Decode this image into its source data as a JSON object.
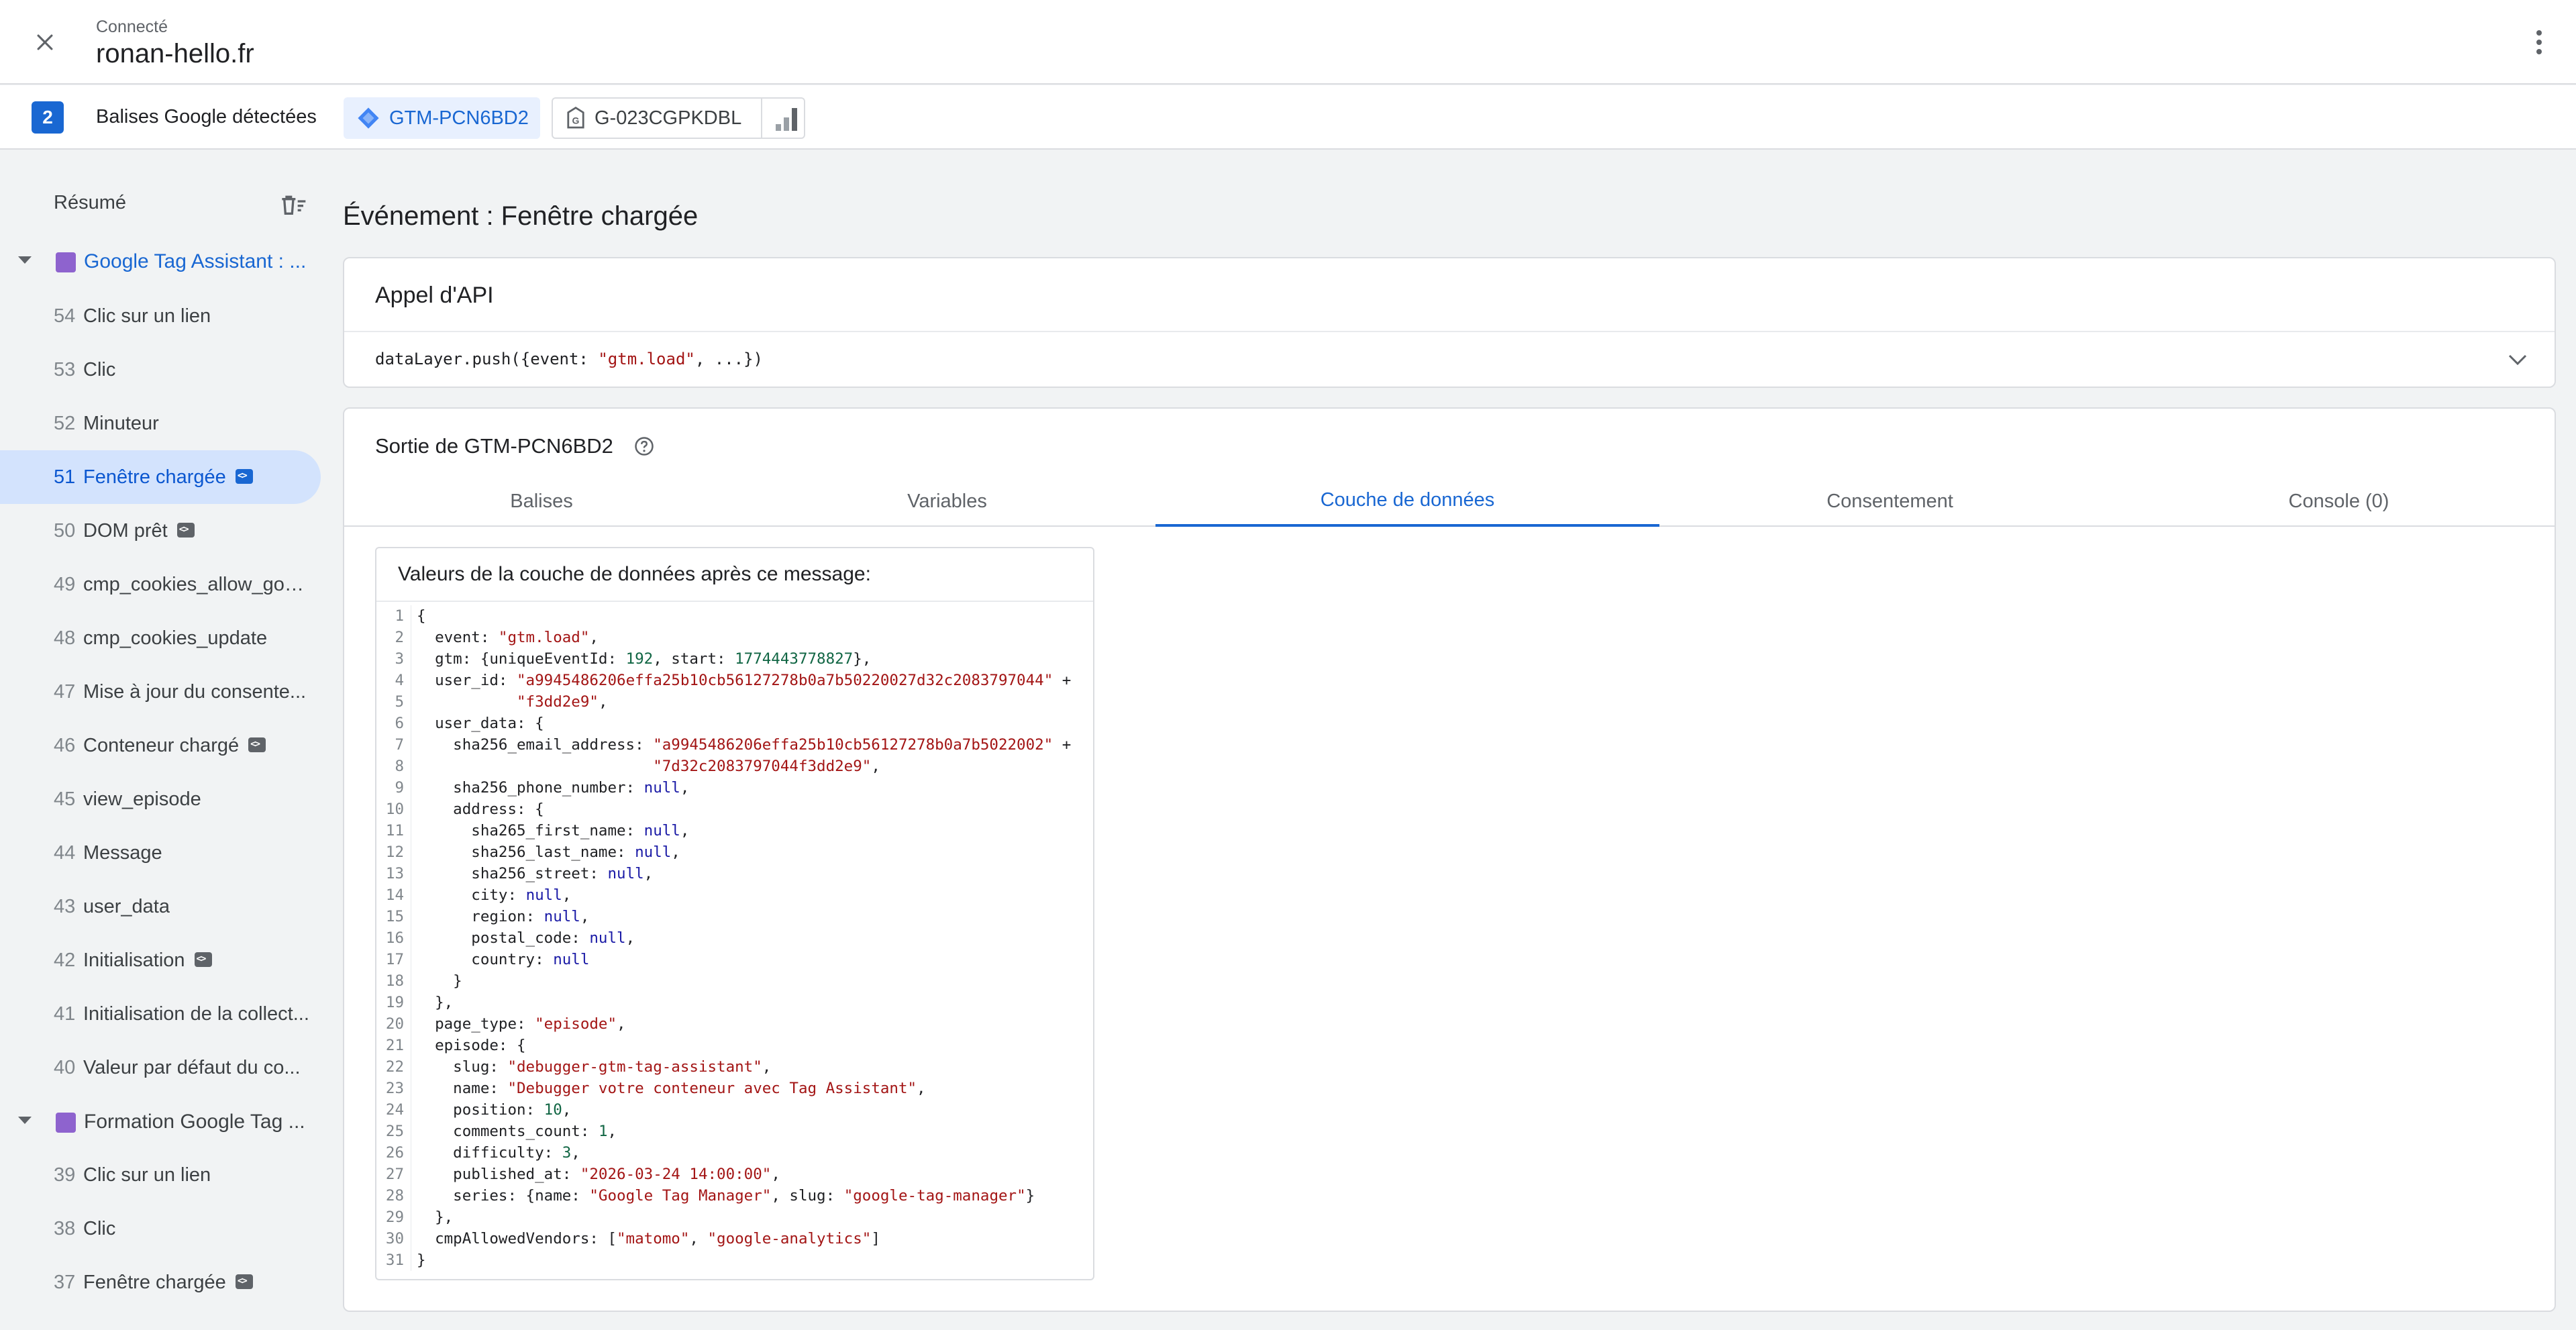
{
  "header": {
    "connection_status": "Connecté",
    "site": "ronan-hello.fr"
  },
  "tags_bar": {
    "count": "2",
    "label": "Balises Google détectées",
    "gtm_id": "GTM-PCN6BD2",
    "ga_id": "G-023CGPKDBL"
  },
  "sidebar": {
    "summary_label": "Résumé",
    "group1": "Google Tag Assistant : ...",
    "group2": "Formation Google Tag ...",
    "events": [
      {
        "num": "54",
        "label": "Clic sur un lien"
      },
      {
        "num": "53",
        "label": "Clic"
      },
      {
        "num": "52",
        "label": "Minuteur"
      },
      {
        "num": "51",
        "label": "Fenêtre chargée"
      },
      {
        "num": "50",
        "label": "DOM prêt"
      },
      {
        "num": "49",
        "label": "cmp_cookies_allow_goo..."
      },
      {
        "num": "48",
        "label": "cmp_cookies_update"
      },
      {
        "num": "47",
        "label": "Mise à jour du consente..."
      },
      {
        "num": "46",
        "label": "Conteneur chargé"
      },
      {
        "num": "45",
        "label": "view_episode"
      },
      {
        "num": "44",
        "label": "Message"
      },
      {
        "num": "43",
        "label": "user_data"
      },
      {
        "num": "42",
        "label": "Initialisation"
      },
      {
        "num": "41",
        "label": "Initialisation de la collect..."
      },
      {
        "num": "40",
        "label": "Valeur par défaut du co..."
      }
    ],
    "events2": [
      {
        "num": "39",
        "label": "Clic sur un lien"
      },
      {
        "num": "38",
        "label": "Clic"
      },
      {
        "num": "37",
        "label": "Fenêtre chargée"
      }
    ]
  },
  "main": {
    "event_title": "Événement : Fenêtre chargée",
    "api_card": {
      "title": "Appel d'API",
      "code_prefix": "dataLayer.push({event: ",
      "code_event": "\"gtm.load\"",
      "code_suffix": ", ...})"
    },
    "output_card": {
      "title": "Sortie de GTM-PCN6BD2",
      "tabs": [
        "Balises",
        "Variables",
        "Couche de données",
        "Consentement",
        "Console (0)"
      ],
      "active_tab": "Couche de données",
      "datalayer_heading": "Valeurs de la couche de données après ce message:"
    }
  },
  "code_lines": [
    [
      [
        "p",
        "{"
      ]
    ],
    [
      [
        "p",
        "  event: "
      ],
      [
        "s",
        "\"gtm.load\""
      ],
      [
        "p",
        ","
      ]
    ],
    [
      [
        "p",
        "  gtm: {uniqueEventId: "
      ],
      [
        "n",
        "192"
      ],
      [
        "p",
        ", start: "
      ],
      [
        "n",
        "1774443778827"
      ],
      [
        "p",
        "},"
      ]
    ],
    [
      [
        "p",
        "  user_id: "
      ],
      [
        "s",
        "\"a9945486206effa25b10cb56127278b0a7b50220027d32c2083797044\""
      ],
      [
        "p",
        " +"
      ]
    ],
    [
      [
        "p",
        "           "
      ],
      [
        "s",
        "\"f3dd2e9\""
      ],
      [
        "p",
        ","
      ]
    ],
    [
      [
        "p",
        "  user_data: {"
      ]
    ],
    [
      [
        "p",
        "    sha256_email_address: "
      ],
      [
        "s",
        "\"a9945486206effa25b10cb56127278b0a7b5022002\""
      ],
      [
        "p",
        " +"
      ]
    ],
    [
      [
        "p",
        "                          "
      ],
      [
        "s",
        "\"7d32c2083797044f3dd2e9\""
      ],
      [
        "p",
        ","
      ]
    ],
    [
      [
        "p",
        "    sha256_phone_number: "
      ],
      [
        "k",
        "null"
      ],
      [
        "p",
        ","
      ]
    ],
    [
      [
        "p",
        "    address: {"
      ]
    ],
    [
      [
        "p",
        "      sha265_first_name: "
      ],
      [
        "k",
        "null"
      ],
      [
        "p",
        ","
      ]
    ],
    [
      [
        "p",
        "      sha256_last_name: "
      ],
      [
        "k",
        "null"
      ],
      [
        "p",
        ","
      ]
    ],
    [
      [
        "p",
        "      sha256_street: "
      ],
      [
        "k",
        "null"
      ],
      [
        "p",
        ","
      ]
    ],
    [
      [
        "p",
        "      city: "
      ],
      [
        "k",
        "null"
      ],
      [
        "p",
        ","
      ]
    ],
    [
      [
        "p",
        "      region: "
      ],
      [
        "k",
        "null"
      ],
      [
        "p",
        ","
      ]
    ],
    [
      [
        "p",
        "      postal_code: "
      ],
      [
        "k",
        "null"
      ],
      [
        "p",
        ","
      ]
    ],
    [
      [
        "p",
        "      country: "
      ],
      [
        "k",
        "null"
      ]
    ],
    [
      [
        "p",
        "    }"
      ]
    ],
    [
      [
        "p",
        "  },"
      ]
    ],
    [
      [
        "p",
        "  page_type: "
      ],
      [
        "s",
        "\"episode\""
      ],
      [
        "p",
        ","
      ]
    ],
    [
      [
        "p",
        "  episode: {"
      ]
    ],
    [
      [
        "p",
        "    slug: "
      ],
      [
        "s",
        "\"debugger-gtm-tag-assistant\""
      ],
      [
        "p",
        ","
      ]
    ],
    [
      [
        "p",
        "    name: "
      ],
      [
        "s",
        "\"Debugger votre conteneur avec Tag Assistant\""
      ],
      [
        "p",
        ","
      ]
    ],
    [
      [
        "p",
        "    position: "
      ],
      [
        "n",
        "10"
      ],
      [
        "p",
        ","
      ]
    ],
    [
      [
        "p",
        "    comments_count: "
      ],
      [
        "n",
        "1"
      ],
      [
        "p",
        ","
      ]
    ],
    [
      [
        "p",
        "    difficulty: "
      ],
      [
        "n",
        "3"
      ],
      [
        "p",
        ","
      ]
    ],
    [
      [
        "p",
        "    published_at: "
      ],
      [
        "s",
        "\"2026-03-24 14:00:00\""
      ],
      [
        "p",
        ","
      ]
    ],
    [
      [
        "p",
        "    series: {name: "
      ],
      [
        "s",
        "\"Google Tag Manager\""
      ],
      [
        "p",
        ", slug: "
      ],
      [
        "s",
        "\"google-tag-manager\""
      ],
      [
        "p",
        "}"
      ]
    ],
    [
      [
        "p",
        "  },"
      ]
    ],
    [
      [
        "p",
        "  cmpAllowedVendors: ["
      ],
      [
        "s",
        "\"matomo\""
      ],
      [
        "p",
        ", "
      ],
      [
        "s",
        "\"google-analytics\""
      ],
      [
        "p",
        "]"
      ]
    ],
    [
      [
        "p",
        "}"
      ]
    ]
  ]
}
